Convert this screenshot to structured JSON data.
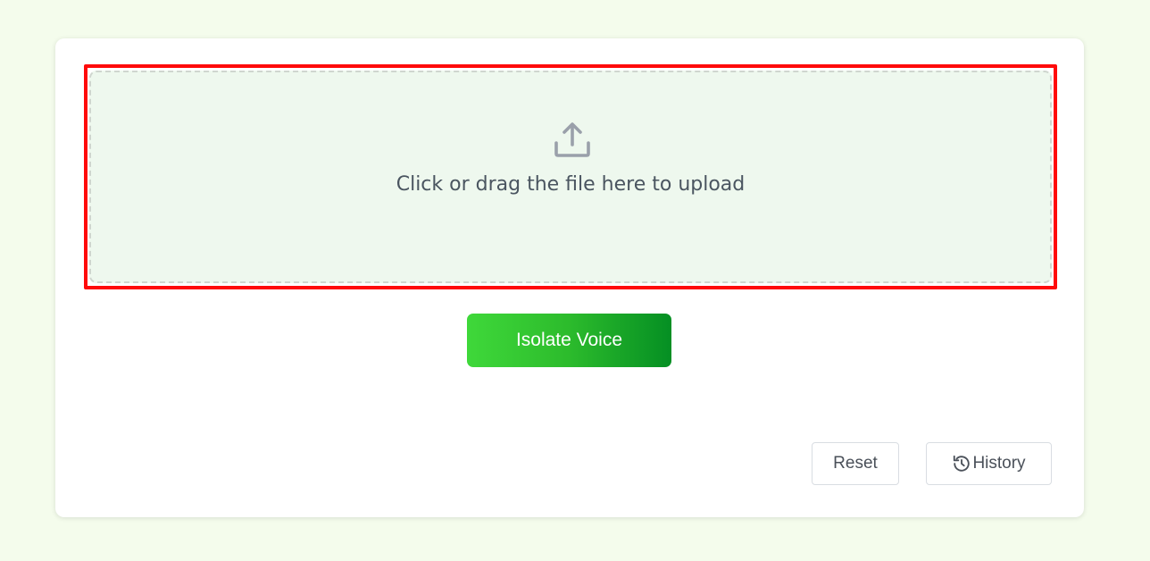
{
  "upload": {
    "icon": "upload-icon",
    "text": "Click or drag the file here to upload"
  },
  "actions": {
    "isolate_label": "Isolate Voice",
    "reset_label": "Reset",
    "history_label": "History",
    "history_icon": "history-icon"
  },
  "colors": {
    "background": "#f4fcec",
    "highlight_border": "#ff0a0a",
    "dropzone_bg": "#eef8ee",
    "primary_gradient_start": "#3fd83a",
    "primary_gradient_end": "#058f23"
  }
}
